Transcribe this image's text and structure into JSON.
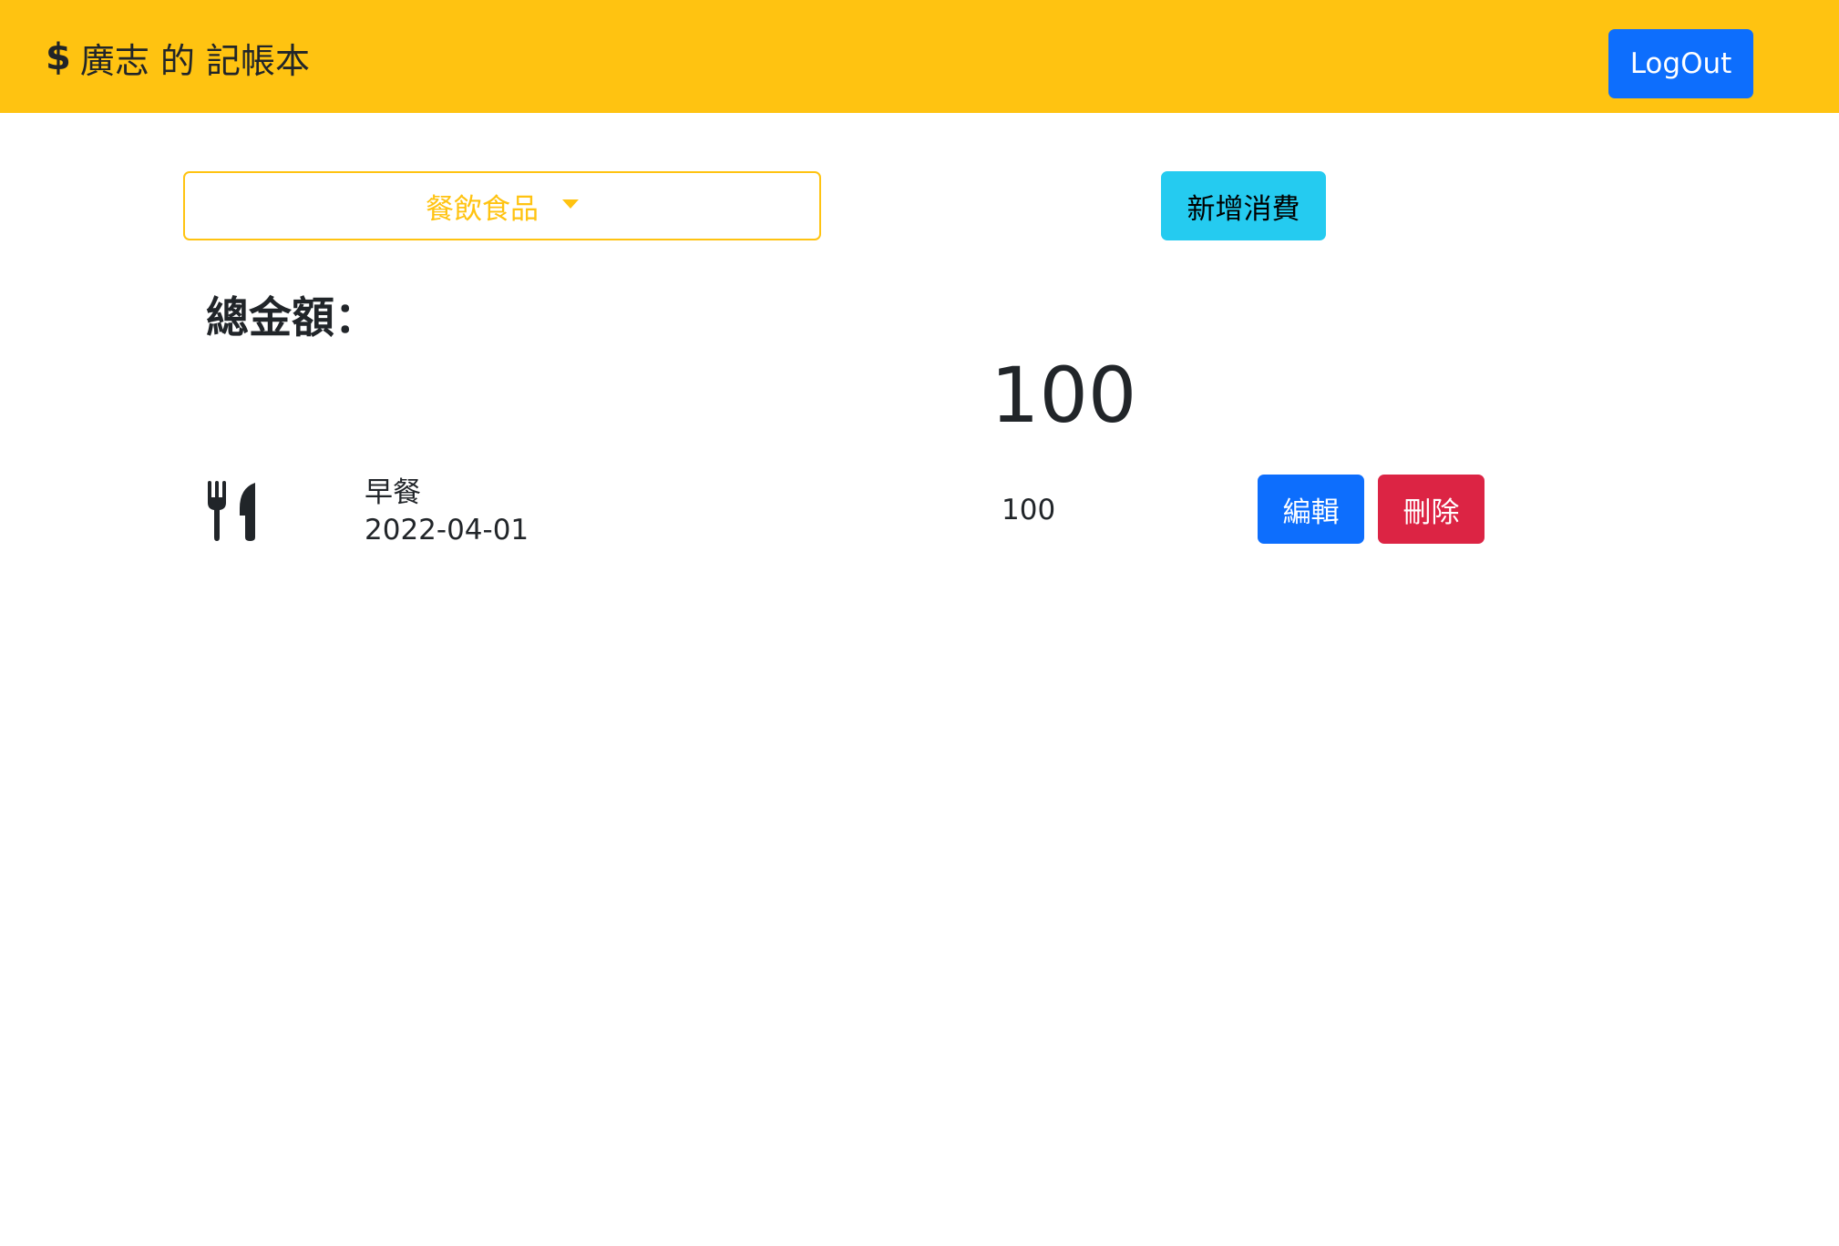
{
  "navbar": {
    "brand_icon": "dollar-sign-icon",
    "brand_symbol": "$",
    "brand_text": "廣志 的 記帳本",
    "logout_label": "LogOut",
    "background_color": "#ffc311"
  },
  "toolbar": {
    "category_selected": "餐飲食品",
    "add_label": "新增消費"
  },
  "summary": {
    "total_label": "總金額：",
    "total_value": "100"
  },
  "expenses": [
    {
      "icon": "utensils-icon",
      "name": "早餐",
      "date": "2022-04-01",
      "amount": "100",
      "edit_label": "編輯",
      "delete_label": "刪除"
    }
  ],
  "colors": {
    "primary": "#0d6efd",
    "danger": "#dc2444",
    "info": "#25cbf0",
    "warning": "#ffc311"
  }
}
